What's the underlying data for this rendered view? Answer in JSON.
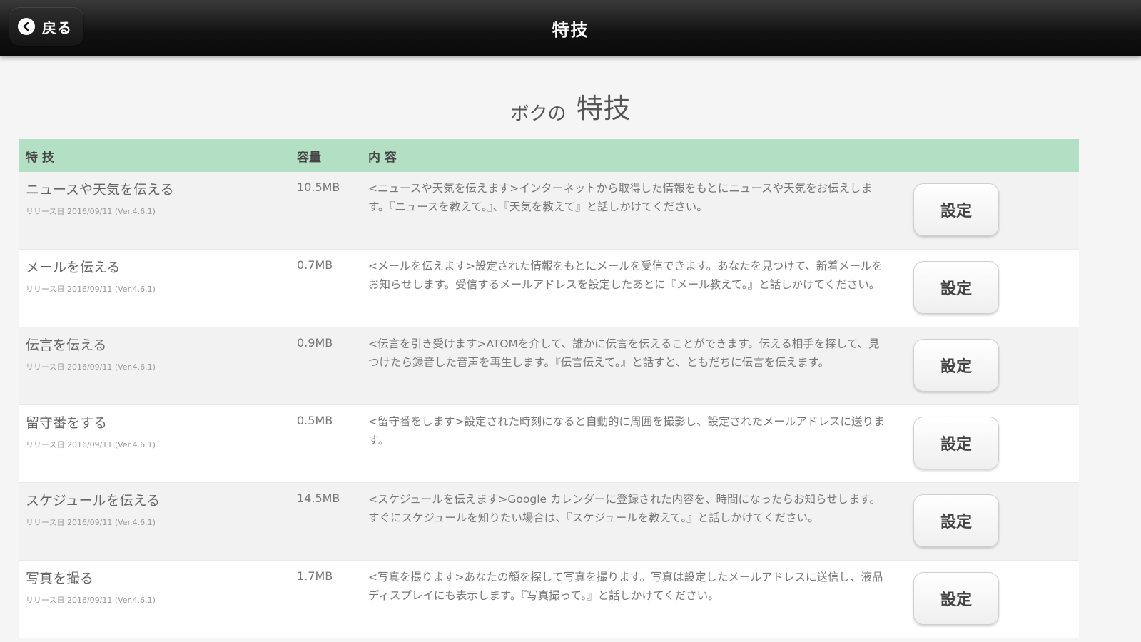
{
  "navbar": {
    "back_label": "戻る",
    "title": "特技"
  },
  "heading": {
    "prefix": "ボクの",
    "main": "特技"
  },
  "table": {
    "headers": {
      "name": "特 技",
      "size": "容量",
      "desc": "内 容"
    },
    "rows": [
      {
        "name": "ニュースや天気を伝える",
        "release": "リリース日 2016/09/11 (Ver.4.6.1)",
        "size": "10.5MB",
        "desc": "<ニュースや天気を伝えます>インターネットから取得した情報をもとにニュースや天気をお伝えします。『ニュースを教えて。』、『天気を教えて』と話しかけてください。",
        "action": "設定"
      },
      {
        "name": "メールを伝える",
        "release": "リリース日 2016/09/11 (Ver.4.6.1)",
        "size": "0.7MB",
        "desc": "<メールを伝えます>設定された情報をもとにメールを受信できます。あなたを見つけて、新着メールをお知らせします。受信するメールアドレスを設定したあとに『メール教えて。』と話しかけてください。",
        "action": "設定"
      },
      {
        "name": "伝言を伝える",
        "release": "リリース日 2016/09/11 (Ver.4.6.1)",
        "size": "0.9MB",
        "desc": "<伝言を引き受けます>ATOMを介して、誰かに伝言を伝えることができます。伝える相手を探して、見つけたら録音した音声を再生します。『伝言伝えて。』と話すと、ともだちに伝言を伝えます。",
        "action": "設定"
      },
      {
        "name": "留守番をする",
        "release": "リリース日 2016/09/11 (Ver.4.6.1)",
        "size": "0.5MB",
        "desc": "<留守番をします>設定された時刻になると自動的に周囲を撮影し、設定されたメールアドレスに送ります。",
        "action": "設定"
      },
      {
        "name": "スケジュールを伝える",
        "release": "リリース日 2016/09/11 (Ver.4.6.1)",
        "size": "14.5MB",
        "desc": "<スケジュールを伝えます>Google カレンダーに登録された内容を、時間になったらお知らせします。すぐにスケジュールを知りたい場合は、『スケジュールを教えて。』と話しかけてください。",
        "action": "設定"
      },
      {
        "name": "写真を撮る",
        "release": "リリース日 2016/09/11 (Ver.4.6.1)",
        "size": "1.7MB",
        "desc": "<写真を撮ります>あなたの顔を探して写真を撮ります。写真は設定したメールアドレスに送信し、液晶ディスプレイにも表示します。『写真撮って。』と話しかけてください。",
        "action": "設定"
      }
    ]
  }
}
